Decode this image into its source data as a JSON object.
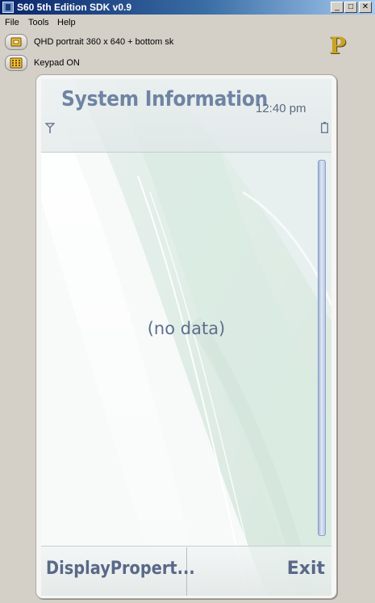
{
  "window": {
    "title": "S60 5th Edition SDK v0.9",
    "controls": {
      "minimize": "_",
      "maximize": "□",
      "close": "✕"
    }
  },
  "menu": [
    {
      "label": "File"
    },
    {
      "label": "Tools"
    },
    {
      "label": "Help"
    }
  ],
  "toolbar": {
    "resolution_label": "QHD portrait 360 x 640 + bottom sk",
    "keypad_label": "Keypad ON",
    "logo_letter": "P"
  },
  "device": {
    "app_title": "System Information",
    "clock": "12:40 pm",
    "content_text": "(no data)",
    "left_softkey": "DisplayPropert...",
    "right_softkey": "Exit"
  },
  "icons": {
    "app": "s60-sdk-app-icon",
    "resolution": "screen-resolution-icon",
    "keypad": "keypad-icon",
    "signal": "signal-antenna-icon",
    "battery": "battery-icon"
  },
  "colors": {
    "titlebar_start": "#0a246a",
    "titlebar_end": "#a6caf0",
    "chrome": "#d4d0c8",
    "device_text": "#5a6888",
    "app_title": "#6f84a3"
  }
}
